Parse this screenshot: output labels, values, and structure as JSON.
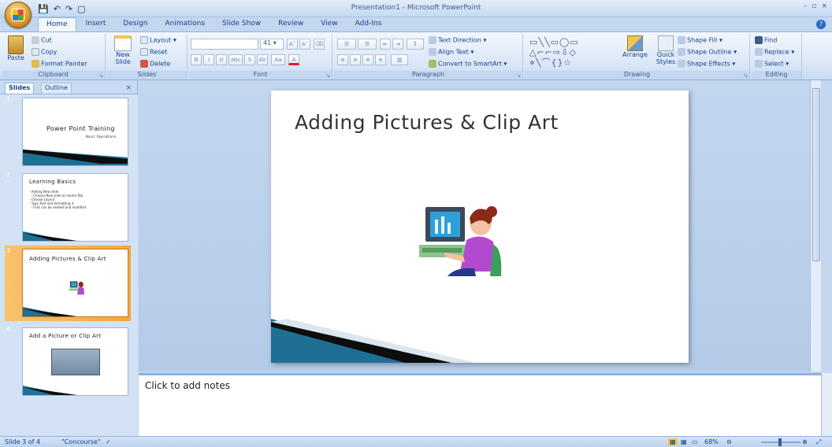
{
  "window": {
    "title": "Presentation1 - Microsoft PowerPoint",
    "controls": [
      "–",
      "▫",
      "×"
    ]
  },
  "quick_access": {
    "save": "💾",
    "undo": "↶",
    "redo": "↷",
    "new": "▢"
  },
  "tabs": [
    "Home",
    "Insert",
    "Design",
    "Animations",
    "Slide Show",
    "Review",
    "View",
    "Add-Ins"
  ],
  "active_tab": "Home",
  "ribbon": {
    "clipboard": {
      "label": "Clipboard",
      "paste": "Paste",
      "cut": "Cut",
      "copy": "Copy",
      "format_painter": "Format Painter"
    },
    "slides": {
      "label": "Slides",
      "new_slide": "New Slide",
      "layout": "Layout",
      "reset": "Reset",
      "delete": "Delete"
    },
    "font": {
      "label": "Font",
      "size": "41",
      "bold": "B",
      "italic": "I",
      "underline": "U",
      "strike": "abc",
      "shadow": "S",
      "spacing": "AV",
      "case": "Aa",
      "color": "A"
    },
    "paragraph": {
      "label": "Paragraph",
      "text_direction": "Text Direction",
      "align_text": "Align Text",
      "convert_smartart": "Convert to SmartArt"
    },
    "drawing": {
      "label": "Drawing",
      "arrange": "Arrange",
      "quick_styles": "Quick Styles",
      "shape_fill": "Shape Fill",
      "shape_outline": "Shape Outline",
      "shape_effects": "Shape Effects"
    },
    "editing": {
      "label": "Editing",
      "find": "Find",
      "replace": "Replace",
      "select": "Select"
    }
  },
  "panel": {
    "tab_slides": "Slides",
    "tab_outline": "Outline",
    "close": "×",
    "thumbnails": [
      {
        "num": "1",
        "title": "Power Point Training",
        "subtitle": "Basic Operations"
      },
      {
        "num": "2",
        "title": "Learning Basics",
        "bullets": "- Adding New slide\n  - Choose New slide on Home Tab\n- Choose Layout\n- Type Text and formatting it\n  - Font can be seeded and modified"
      },
      {
        "num": "3",
        "title": "Adding Pictures & Clip Art"
      },
      {
        "num": "4",
        "title": "Add a Picture or Clip Art"
      }
    ]
  },
  "slide": {
    "title": "Adding Pictures & Clip Art"
  },
  "notes": {
    "placeholder": "Click to add notes"
  },
  "status": {
    "slide": "Slide 3 of 4",
    "theme": "\"Concourse\"",
    "zoom": "68%"
  },
  "colors": {
    "ribbon": "#dbe7f6",
    "selection": "#f5a53d",
    "accent": "#15428b"
  }
}
